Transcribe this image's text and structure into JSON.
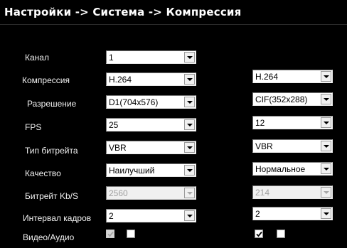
{
  "title": "Настройки -> Система -> Компрессия",
  "labels": {
    "channel": "Канал",
    "compression": "Компрессия",
    "resolution": "Разрешение",
    "fps": "FPS",
    "bitrate_type": "Тип битрейта",
    "quality": "Качество",
    "bitrate": "Битрейт Kb/S",
    "frame_interval": "Интервал кадров",
    "video_audio": "Видео/Аудио"
  },
  "channel": "1",
  "main": {
    "compression": "H.264",
    "resolution": "D1(704x576)",
    "fps": "25",
    "bitrate_type": "VBR",
    "quality": "Наилучший",
    "bitrate": "2560",
    "frame_interval": "2",
    "video_checked": true,
    "audio_checked": false
  },
  "extra": {
    "compression": "H.264",
    "resolution": "CIF(352x288)",
    "fps": "12",
    "bitrate_type": "VBR",
    "quality": "Нормальное",
    "bitrate": "214",
    "frame_interval": "2",
    "video_checked": true,
    "audio_checked": false
  },
  "icons": {
    "dropdown": "chevron-down-icon",
    "check": "checkmark-icon"
  }
}
